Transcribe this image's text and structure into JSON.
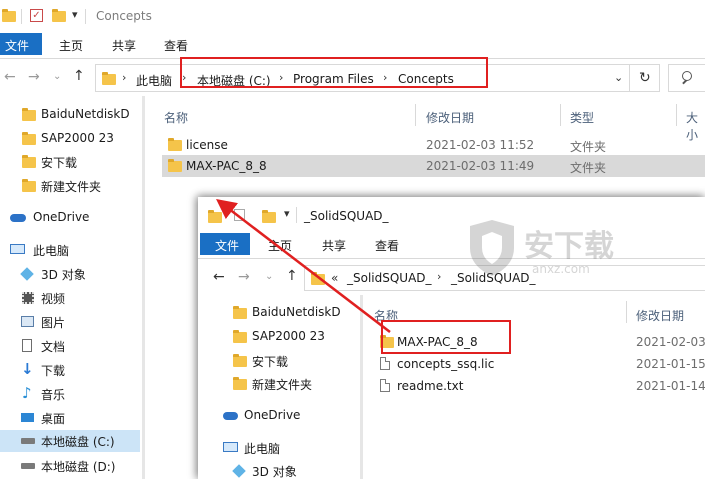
{
  "main": {
    "title": "Concepts",
    "ribbon": {
      "file": "文件",
      "home": "主页",
      "share": "共享",
      "view": "查看"
    },
    "breadcrumb": [
      "此电脑",
      "本地磁盘 (C:)",
      "Program Files",
      "Concepts"
    ],
    "columns": {
      "name": "名称",
      "date": "修改日期",
      "type": "类型",
      "size": "大小"
    },
    "rows": [
      {
        "name": "license",
        "date": "2021-02-03 11:52",
        "type": "文件夹"
      },
      {
        "name": "MAX-PAC_8_8",
        "date": "2021-02-03 11:49",
        "type": "文件夹"
      }
    ],
    "sidebar": [
      {
        "label": "BaiduNetdiskD",
        "icon": "folder-icon"
      },
      {
        "label": "SAP2000 23",
        "icon": "folder-icon"
      },
      {
        "label": "安下载",
        "icon": "folder-icon"
      },
      {
        "label": "新建文件夹",
        "icon": "folder-icon"
      },
      {
        "label": "OneDrive",
        "icon": "onedrive-icon"
      },
      {
        "label": "此电脑",
        "icon": "computer-icon"
      },
      {
        "label": "3D 对象",
        "icon": "3d-objects-icon"
      },
      {
        "label": "视频",
        "icon": "video-icon"
      },
      {
        "label": "图片",
        "icon": "pictures-icon"
      },
      {
        "label": "文档",
        "icon": "documents-icon"
      },
      {
        "label": "下载",
        "icon": "download-icon"
      },
      {
        "label": "音乐",
        "icon": "music-icon"
      },
      {
        "label": "桌面",
        "icon": "desktop-icon"
      },
      {
        "label": "本地磁盘 (C:)",
        "icon": "drive-icon"
      },
      {
        "label": "本地磁盘 (D:)",
        "icon": "drive-icon"
      }
    ]
  },
  "overlay": {
    "title": "_SolidSQUAD_",
    "ribbon": {
      "file": "文件",
      "home": "主页",
      "share": "共享",
      "view": "查看"
    },
    "breadcrumb": [
      "«",
      "_SolidSQUAD_",
      "_SolidSQUAD_"
    ],
    "columns": {
      "name": "名称",
      "date": "修改日期"
    },
    "rows": [
      {
        "name": "MAX-PAC_8_8",
        "date": "2021-02-03"
      },
      {
        "name": "concepts_ssq.lic",
        "date": "2021-01-15"
      },
      {
        "name": "readme.txt",
        "date": "2021-01-14"
      }
    ],
    "sidebar": [
      {
        "label": "BaiduNetdiskD"
      },
      {
        "label": "SAP2000 23"
      },
      {
        "label": "安下载"
      },
      {
        "label": "新建文件夹"
      },
      {
        "label": "OneDrive"
      },
      {
        "label": "此电脑"
      },
      {
        "label": "3D 对象"
      }
    ]
  },
  "watermark": {
    "text": "anxz.com"
  },
  "colors": {
    "accent": "#1a6fc4",
    "annotation": "#e02020",
    "folder": "#f5c44a",
    "selected_row": "#cce4f7"
  }
}
